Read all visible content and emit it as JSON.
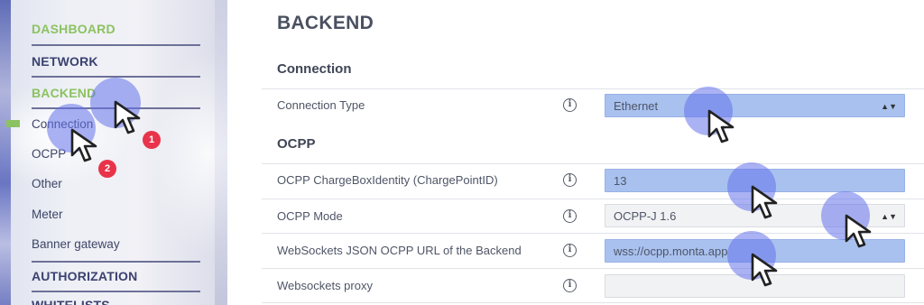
{
  "sidebar": {
    "sections": {
      "dashboard": "DASHBOARD",
      "network": "NETWORK",
      "backend": "BACKEND",
      "authorization": "AUTHORIZATION",
      "whitelists": "WHITELISTS"
    },
    "items": [
      "Connection",
      "OCPP",
      "Other",
      "Meter",
      "Banner gateway"
    ]
  },
  "main": {
    "title": "BACKEND",
    "connection": {
      "heading": "Connection",
      "connection_type_label": "Connection Type",
      "connection_type_value": "Ethernet"
    },
    "ocpp": {
      "heading": "OCPP",
      "chargebox_label": "OCPP ChargeBoxIdentity (ChargePointID)",
      "chargebox_value": "13",
      "mode_label": "OCPP Mode",
      "mode_value": "OCPP-J 1.6",
      "url_label": "WebSockets JSON OCPP URL of the Backend",
      "url_value": "wss://ocpp.monta.app",
      "proxy_label": "Websockets proxy",
      "proxy_value": ""
    }
  },
  "steps": [
    "1",
    "2"
  ],
  "icons": {
    "info": "i"
  },
  "colors": {
    "accent_green": "#8cc261",
    "highlight_blue": "#a9c1ef",
    "badge_red": "#e8334a",
    "nav_dark": "#3b4170"
  }
}
